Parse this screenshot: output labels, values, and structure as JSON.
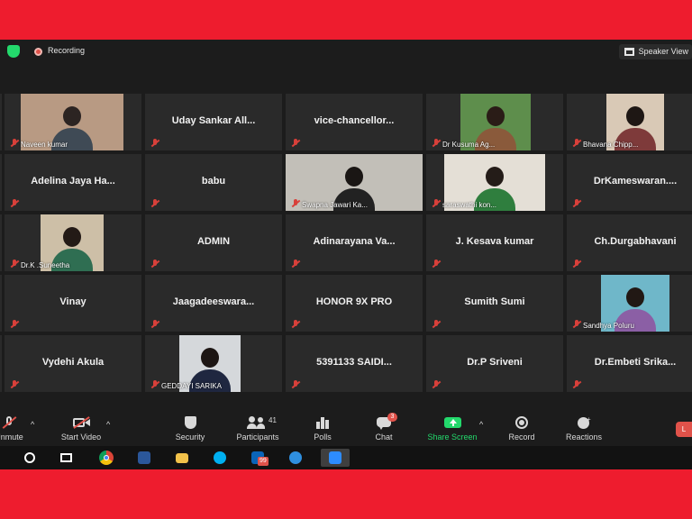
{
  "topbar": {
    "recording_label": "Recording",
    "speaker_view_label": "Speaker View"
  },
  "tiles": [
    {
      "name": "Naveen kumar",
      "video": true
    },
    {
      "name": "Uday Sankar All...",
      "video": false
    },
    {
      "name": "vice-chancellor...",
      "video": false
    },
    {
      "name": "Dr Kusuma Ag...",
      "video": true
    },
    {
      "name": "Bhavana Chipp...",
      "video": true
    },
    {
      "name": "Adelina Jaya Ha...",
      "video": false
    },
    {
      "name": "babu",
      "video": false
    },
    {
      "name": "Swapna Jawari Ka...",
      "video": true,
      "active": true
    },
    {
      "name": "saraswathi kon...",
      "video": true
    },
    {
      "name": "DrKameswaran....",
      "video": false
    },
    {
      "name": "Dr.K .Suneetha",
      "video": true
    },
    {
      "name": "ADMIN",
      "video": false
    },
    {
      "name": "Adinarayana  Va...",
      "video": false
    },
    {
      "name": "J. Kesava kumar",
      "video": false
    },
    {
      "name": "Ch.Durgabhavani",
      "video": false
    },
    {
      "name": "Vinay",
      "video": false
    },
    {
      "name": "Jaagadeeswara...",
      "video": false
    },
    {
      "name": "HONOR 9X PRO",
      "video": false
    },
    {
      "name": "Sumith Sumi",
      "video": false
    },
    {
      "name": "Sandhya Poluru",
      "video": true
    },
    {
      "name": "Vydehi Akula",
      "video": false
    },
    {
      "name": "GEDDAYI SARIKA",
      "video": true
    },
    {
      "name": "5391133 SAIDI...",
      "video": false
    },
    {
      "name": "Dr.P Sriveni",
      "video": false
    },
    {
      "name": "Dr.Embeti  Srika...",
      "video": false
    }
  ],
  "toolbar": {
    "unmute_label": "Unmute",
    "start_video_label": "Start Video",
    "security_label": "Security",
    "participants_label": "Participants",
    "participants_count": "41",
    "polls_label": "Polls",
    "chat_label": "Chat",
    "chat_badge": "3",
    "share_screen_label": "Share Screen",
    "record_label": "Record",
    "reactions_label": "Reactions",
    "leave_label": "L"
  },
  "taskbar": {
    "outlook_badge": "99"
  },
  "colors": {
    "frame_red": "#ee1c2e",
    "zoom_bg": "#1c1c1c",
    "tile_bg": "#2a2a2a",
    "active_speaker": "#c9e44d",
    "share_green": "#23d96c",
    "muted_red": "#d8403a"
  },
  "icons": [
    "shield-icon",
    "record-dot-icon",
    "grid-view-icon",
    "muted-mic-icon",
    "mic-icon",
    "video-off-icon",
    "security-icon",
    "participants-icon",
    "polls-icon",
    "chat-icon",
    "share-screen-icon",
    "record-icon",
    "reactions-icon",
    "windows-start-icon",
    "task-view-icon",
    "chrome-icon",
    "word-icon",
    "file-explorer-icon",
    "skype-icon",
    "outlook-icon",
    "edge-icon",
    "zoom-icon"
  ]
}
